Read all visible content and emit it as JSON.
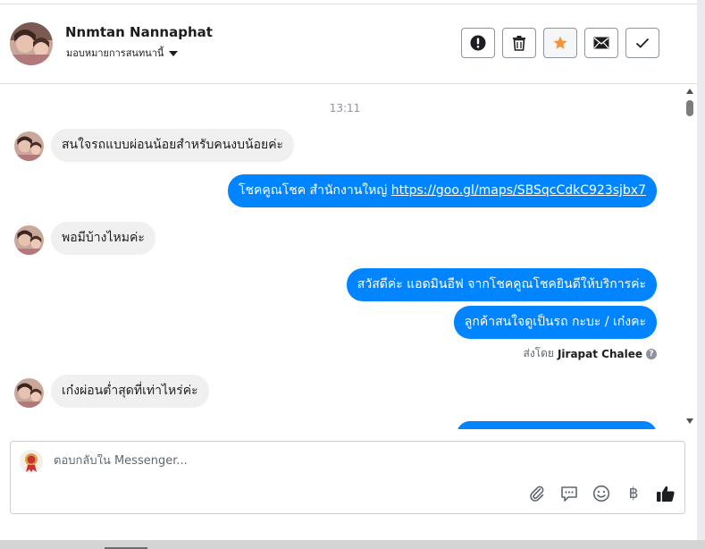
{
  "header": {
    "contact_name": "Nnmtan Nannaphat",
    "assign_label": "มอบหมายการสนทนานี้",
    "actions": [
      {
        "name": "spam-button",
        "icon": "exclamation-circle-icon"
      },
      {
        "name": "delete-button",
        "icon": "trash-icon"
      },
      {
        "name": "star-button",
        "icon": "star-icon",
        "color": "#f7923b"
      },
      {
        "name": "email-button",
        "icon": "envelope-icon"
      },
      {
        "name": "done-button",
        "icon": "checkmark-icon"
      }
    ]
  },
  "thread": {
    "timestamp": "13:11",
    "messages": [
      {
        "direction": "in",
        "text": "สนใจรถแบบผ่อนน้อยสำหรับคนงบน้อยค่ะ"
      },
      {
        "direction": "out",
        "text": "โชคคูณโชค สำนักงานใหญ่ ",
        "link": "https://goo.gl/maps/SBSqcCdkC923sjbx7"
      },
      {
        "direction": "in",
        "text": "พอมีบ้างไหมค่ะ"
      },
      {
        "direction": "out",
        "text": "สวัสดีค่ะ แอดมินอีฟ จากโชคคูณโชคยินดีให้บริการค่ะ"
      },
      {
        "direction": "out",
        "text": "ลูกค้าสนใจดูเป็นรถ กะบะ / เก๋งคะ"
      },
      {
        "direction": "in",
        "text": "เก๋งผ่อนต่ำสุดที่เท่าไหร่ค่ะ"
      }
    ],
    "sent_by_prefix": "ส่งโดย",
    "sent_by_name": "Jirapat Chalee",
    "help_glyph": "?"
  },
  "composer": {
    "placeholder": "ตอบกลับใน Messenger...",
    "tools": [
      "paperclip-icon",
      "speech-bubble-icon",
      "smiley-icon",
      "baht-icon",
      "thumbs-up-icon"
    ],
    "baht_glyph": "฿"
  },
  "colors": {
    "accent": "#0084ff",
    "incoming_bubble": "#f1f0f0",
    "star": "#f7923b"
  }
}
